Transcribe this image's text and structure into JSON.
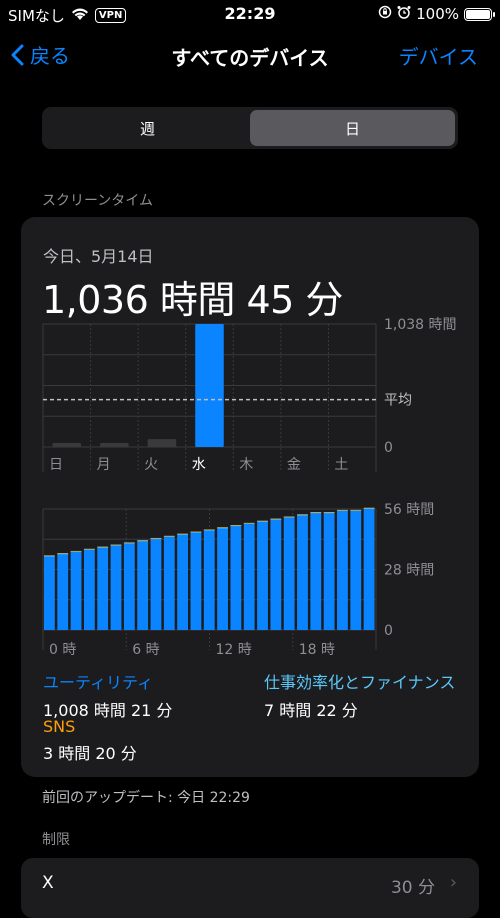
{
  "status": {
    "carrier": "SIMなし",
    "vpn": "VPN",
    "time": "22:29",
    "battery": "100%"
  },
  "nav": {
    "back": "戻る",
    "title": "すべてのデバイス",
    "right": "デバイス"
  },
  "segment": {
    "week": "週",
    "day": "日",
    "selected": "日"
  },
  "screen_time": {
    "section": "スクリーンタイム",
    "date": "今日、5月14日",
    "total": "1,036 時間 45 分"
  },
  "chart_data": [
    {
      "type": "bar",
      "categories": [
        "日",
        "月",
        "火",
        "水",
        "木",
        "金",
        "土"
      ],
      "values": [
        7,
        8,
        66,
        1038,
        0,
        0,
        0
      ],
      "ylim": [
        0,
        1038
      ],
      "y_ticks": [
        "1,038 時間",
        "0"
      ],
      "average_label": "平均",
      "average_value": 400,
      "highlight": "水",
      "colors": {
        "current": "#0a84ff",
        "past": "#3a3a3c"
      }
    },
    {
      "type": "bar",
      "x_ticks": [
        "0 時",
        "6 時",
        "12 時",
        "18 時"
      ],
      "y_ticks": [
        "56 時間",
        "28 時間",
        "0"
      ],
      "ylim": [
        0,
        56
      ],
      "series": [
        {
          "name": "ユーティリティ",
          "color": "#0a84ff",
          "values": [
            34,
            35,
            36,
            37,
            38,
            39,
            40,
            41,
            42,
            43,
            44,
            45,
            46,
            47,
            48,
            49,
            50,
            51,
            52,
            53,
            54,
            54,
            55,
            55,
            56
          ]
        },
        {
          "name": "仕事効率化とファイナンス",
          "color": "#5ac8fa",
          "values": [
            0.4,
            0.4,
            0.4,
            0.4,
            0.4,
            0.4,
            0.4,
            0.4,
            0.4,
            0.4,
            0.4,
            0.4,
            0.4,
            0.4,
            0.4,
            0.4,
            0.4,
            0.4,
            0.4,
            0.4,
            0.4,
            0.4,
            0.4,
            0.4,
            0.4
          ]
        },
        {
          "name": "SNS",
          "color": "#ff9f0a",
          "values": [
            0.2,
            0.2,
            0.2,
            0.2,
            0.2,
            0.2,
            0.2,
            0.2,
            0.2,
            0.2,
            0.2,
            0.2,
            0.2,
            0.2,
            0.2,
            0.2,
            0.2,
            0.2,
            0.2,
            0.2,
            0.2,
            0.2,
            0.2,
            0.2,
            0.2
          ]
        }
      ]
    }
  ],
  "legend": [
    {
      "name": "ユーティリティ",
      "value": "1,008 時間 21 分",
      "color": "#0a84ff"
    },
    {
      "name": "仕事効率化とファイナンス",
      "value": "7 時間 22 分",
      "color": "#5ac8fa"
    },
    {
      "name": "SNS",
      "value": "3 時間 20 分",
      "color": "#ff9f0a"
    }
  ],
  "footer": "前回のアップデート: 今日 22:29",
  "limits": {
    "section": "制限",
    "item_name": "X",
    "item_value": "30 分"
  }
}
